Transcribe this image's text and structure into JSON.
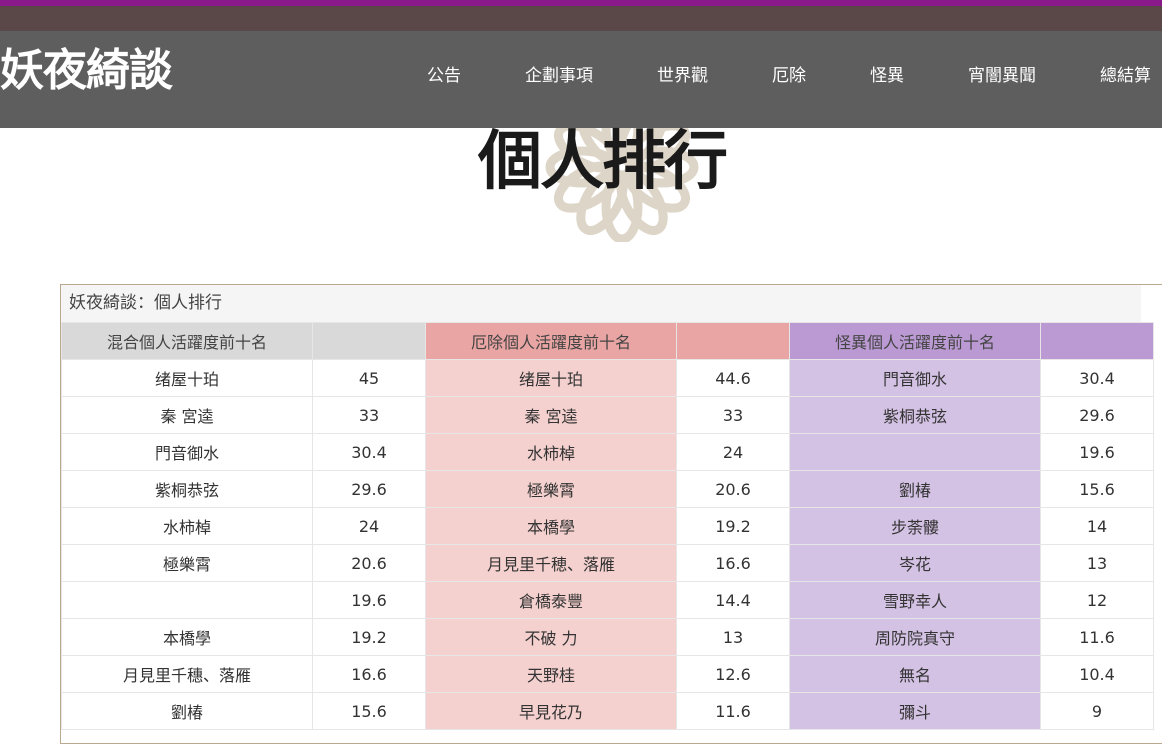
{
  "site": {
    "title": "妖夜綺談"
  },
  "nav": {
    "items": [
      "公告",
      "企劃事項",
      "世界觀",
      "厄除",
      "怪異",
      "宵闇異聞",
      "總結算"
    ]
  },
  "page": {
    "heading": "個人排行"
  },
  "panel": {
    "title": "妖夜綺談：個人排行",
    "headers": {
      "mixed": "混合個人活躍度前十名",
      "yakuyoke": "厄除個人活躍度前十名",
      "kaii": "怪異個人活躍度前十名"
    },
    "rows": [
      {
        "mixed_name": "绪屋十珀",
        "mixed_score": "45",
        "yakuyoke_name": "绪屋十珀",
        "yakuyoke_score": "44.6",
        "kaii_name": "門音御水",
        "kaii_score": "30.4"
      },
      {
        "mixed_name": "秦 宮逵",
        "mixed_score": "33",
        "yakuyoke_name": "秦 宮逵",
        "yakuyoke_score": "33",
        "kaii_name": "紫桐恭弦",
        "kaii_score": "29.6"
      },
      {
        "mixed_name": "門音御水",
        "mixed_score": "30.4",
        "yakuyoke_name": "水柿棹",
        "yakuyoke_score": "24",
        "kaii_name": "",
        "kaii_score": "19.6"
      },
      {
        "mixed_name": "紫桐恭弦",
        "mixed_score": "29.6",
        "yakuyoke_name": "極樂霄",
        "yakuyoke_score": "20.6",
        "kaii_name": "劉椿",
        "kaii_score": "15.6"
      },
      {
        "mixed_name": "水柿棹",
        "mixed_score": "24",
        "yakuyoke_name": "本橋學",
        "yakuyoke_score": "19.2",
        "kaii_name": "步荼髏",
        "kaii_score": "14"
      },
      {
        "mixed_name": "極樂霄",
        "mixed_score": "20.6",
        "yakuyoke_name": "月見里千穂、落雁",
        "yakuyoke_score": "16.6",
        "kaii_name": "岑花",
        "kaii_score": "13"
      },
      {
        "mixed_name": "",
        "mixed_score": "19.6",
        "yakuyoke_name": "倉橋泰豐",
        "yakuyoke_score": "14.4",
        "kaii_name": "雪野幸人",
        "kaii_score": "12"
      },
      {
        "mixed_name": "本橋學",
        "mixed_score": "19.2",
        "yakuyoke_name": "不破 力",
        "yakuyoke_score": "13",
        "kaii_name": "周防院真守",
        "kaii_score": "11.6"
      },
      {
        "mixed_name": "月見里千穗、落雁",
        "mixed_score": "16.6",
        "yakuyoke_name": "天野桂",
        "yakuyoke_score": "12.6",
        "kaii_name": "無名",
        "kaii_score": "10.4"
      },
      {
        "mixed_name": "劉椿",
        "mixed_score": "15.6",
        "yakuyoke_name": "早見花乃",
        "yakuyoke_score": "11.6",
        "kaii_name": "彌斗",
        "kaii_score": "9"
      }
    ]
  },
  "colors": {
    "accent_top": "#8a1a8c",
    "navbar": "#5e5e5e",
    "yakuyoke_header": "#e9a5a3",
    "yakuyoke_cell": "#f4d1cf",
    "kaii_header": "#bb9ad4",
    "kaii_cell": "#d4c2e4"
  }
}
